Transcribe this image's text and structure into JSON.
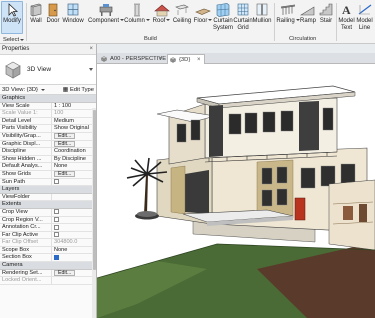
{
  "ribbon": {
    "buttons": [
      {
        "label": "Modify",
        "icon": "cursor-arrow-icon"
      },
      {
        "label": "Wall",
        "icon": "wall-icon"
      },
      {
        "label": "Door",
        "icon": "door-icon"
      },
      {
        "label": "Window",
        "icon": "window-icon"
      },
      {
        "label": "Component",
        "icon": "component-icon"
      },
      {
        "label": "Column",
        "icon": "column-icon"
      },
      {
        "label": "Roof",
        "icon": "roof-icon"
      },
      {
        "label": "Ceiling",
        "icon": "ceiling-icon"
      },
      {
        "label": "Floor",
        "icon": "floor-icon"
      },
      {
        "label": "Curtain System",
        "icon": "curtain-system-icon"
      },
      {
        "label": "Curtain Grid",
        "icon": "curtain-grid-icon"
      },
      {
        "label": "Mullion",
        "icon": "mullion-icon"
      },
      {
        "label": "Railing",
        "icon": "railing-icon"
      },
      {
        "label": "Ramp",
        "icon": "ramp-icon"
      },
      {
        "label": "Stair",
        "icon": "stair-icon"
      },
      {
        "label": "Model Text",
        "icon": "model-text-icon"
      },
      {
        "label": "Model Line",
        "icon": "model-line-icon"
      }
    ],
    "panels": {
      "select": "Select",
      "build": "Build",
      "circulation": "Circulation"
    }
  },
  "properties": {
    "title": "Properties",
    "type_name": "3D View",
    "selector": "3D View: {3D}",
    "edit_type": "Edit Type",
    "rows": [
      {
        "kind": "section",
        "label": "Graphics"
      },
      {
        "kind": "row",
        "k": "View Scale",
        "v": "1 : 100"
      },
      {
        "kind": "row",
        "k": "Scale Value 1:",
        "v": "100",
        "gray": true
      },
      {
        "kind": "row",
        "k": "Detail Level",
        "v": "Medium"
      },
      {
        "kind": "row",
        "k": "Parts Visibility",
        "v": "Show Original"
      },
      {
        "kind": "row",
        "k": "Visibility/Grap...",
        "v": "Edit...",
        "button": true
      },
      {
        "kind": "row",
        "k": "Graphic Displ...",
        "v": "Edit...",
        "button": true
      },
      {
        "kind": "row",
        "k": "Discipline",
        "v": "Coordination"
      },
      {
        "kind": "row",
        "k": "Show Hidden ...",
        "v": "By Discipline"
      },
      {
        "kind": "row",
        "k": "Default Analys...",
        "v": "None"
      },
      {
        "kind": "row",
        "k": "Show Grids",
        "v": "Edit...",
        "button": true
      },
      {
        "kind": "row",
        "k": "Sun Path",
        "v": "",
        "check": false
      },
      {
        "kind": "section",
        "label": "Layers"
      },
      {
        "kind": "row",
        "k": "ViewFolder",
        "v": ""
      },
      {
        "kind": "section",
        "label": "Extents"
      },
      {
        "kind": "row",
        "k": "Crop View",
        "v": "",
        "check": false
      },
      {
        "kind": "row",
        "k": "Crop Region V...",
        "v": "",
        "check": false
      },
      {
        "kind": "row",
        "k": "Annotation Cr...",
        "v": "",
        "check": false
      },
      {
        "kind": "row",
        "k": "Far Clip Active",
        "v": "",
        "check": false
      },
      {
        "kind": "row",
        "k": "Far Clip Offset",
        "v": "304800.0",
        "gray": true
      },
      {
        "kind": "row",
        "k": "Scope Box",
        "v": "None"
      },
      {
        "kind": "row",
        "k": "Section Box",
        "v": "",
        "check": true
      },
      {
        "kind": "section",
        "label": "Camera"
      },
      {
        "kind": "row",
        "k": "Rendering Set...",
        "v": "Edit...",
        "button": true
      },
      {
        "kind": "row",
        "k": "Locked Orient...",
        "v": "",
        "gray": true
      }
    ]
  },
  "tabs": [
    {
      "label": "A00 - PERSPECTIVE",
      "active": false
    },
    {
      "label": "{3D}",
      "active": true
    }
  ],
  "colors": {
    "accent": "#2a6bc9",
    "ribbon": "#f3f3f3",
    "selected": "#cfe3f7"
  }
}
